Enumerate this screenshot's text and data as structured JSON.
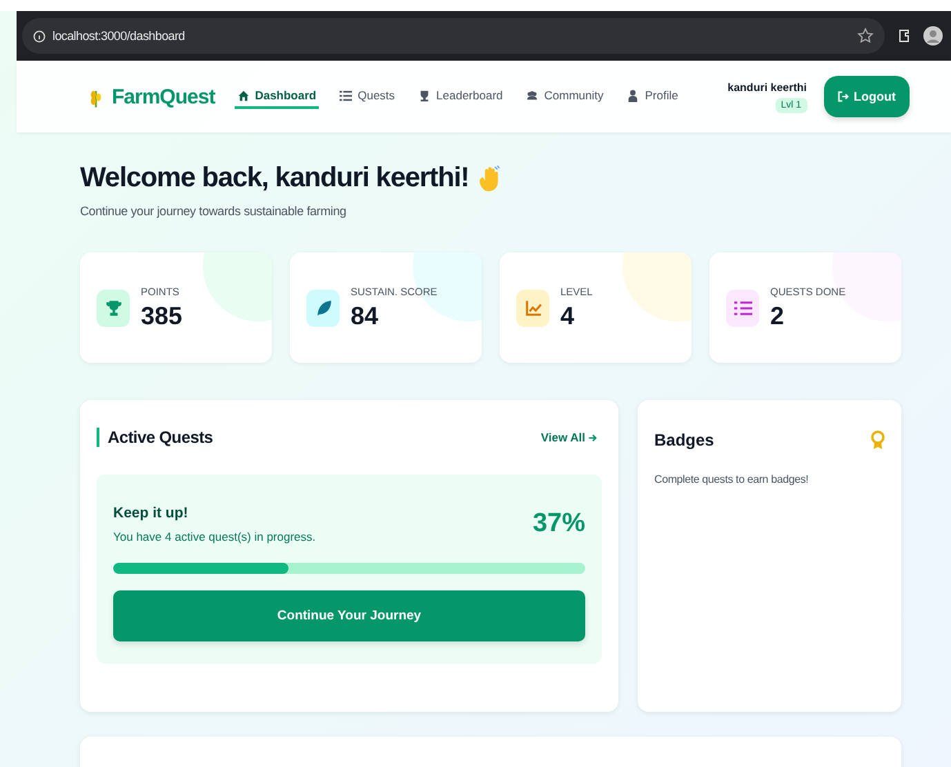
{
  "browser": {
    "url": "localhost:3000/dashboard"
  },
  "nav": {
    "brand": "FarmQuest",
    "items": [
      {
        "label": "Dashboard",
        "kind": "home",
        "selected": true
      },
      {
        "label": "Quests",
        "kind": "list",
        "selected": false
      },
      {
        "label": "Leaderboard",
        "kind": "trophy",
        "selected": false
      },
      {
        "label": "Community",
        "kind": "people",
        "selected": false
      },
      {
        "label": "Profile",
        "kind": "person",
        "selected": false
      }
    ],
    "user": {
      "name": "kanduri keerthi",
      "level": "Lvl 1"
    },
    "logout": "Logout"
  },
  "welcome": {
    "title": "Welcome back, kanduri keerthi!",
    "subtitle": "Continue your journey towards sustainable farming"
  },
  "stats": [
    {
      "label": "POINTS",
      "value": "385",
      "kind": "trophy",
      "color": "#059669"
    },
    {
      "label": "SUSTAIN. SCORE",
      "value": "84",
      "kind": "leaf",
      "color": "#0e7490"
    },
    {
      "label": "LEVEL",
      "value": "4",
      "kind": "chart",
      "color": "#d97706"
    },
    {
      "label": "QUESTS DONE",
      "value": "2",
      "kind": "list",
      "color": "#c026d3"
    }
  ],
  "active_quests": {
    "title": "Active Quests",
    "view_all": "View All",
    "progress": {
      "title": "Keep it up!",
      "text": "You have 4 active quest(s) in progress.",
      "percent": "37%",
      "level": 0.37
    },
    "button": "Continue Your Journey"
  },
  "badges": {
    "title": "Badges",
    "empty_text": "Complete quests to earn badges!"
  }
}
